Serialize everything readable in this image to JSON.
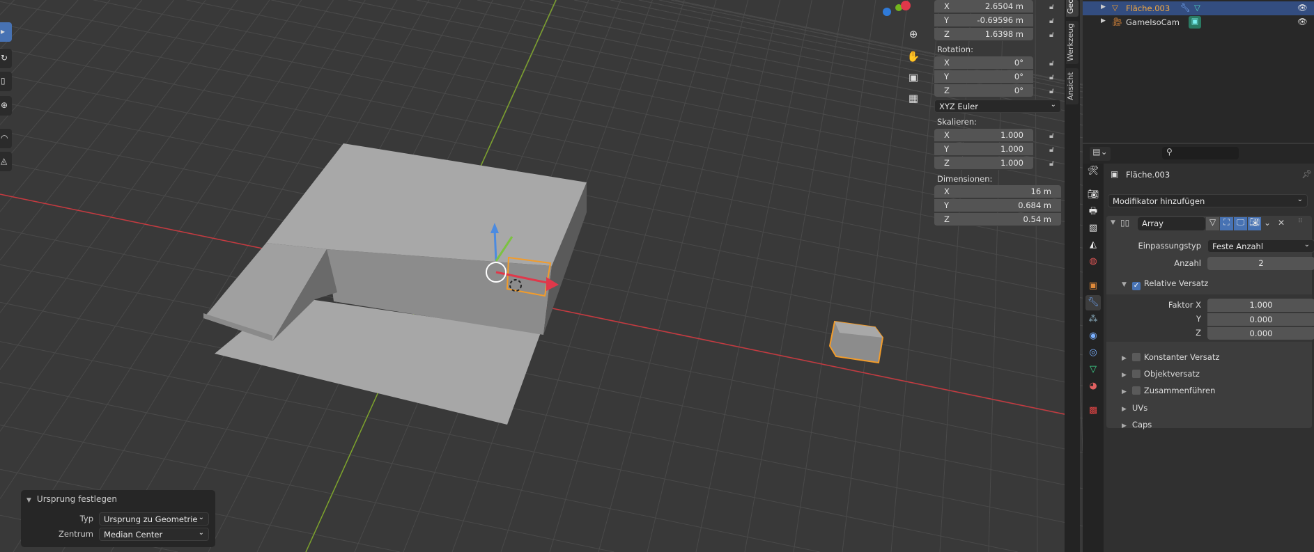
{
  "toolbar": {
    "tools": [
      "select-box",
      "cursor",
      "move",
      "scale",
      "transform",
      "annotate",
      "measure"
    ]
  },
  "npanel": {
    "location": [
      {
        "axis": "X",
        "value": "2.6504 m"
      },
      {
        "axis": "Y",
        "value": "-0.69596 m"
      },
      {
        "axis": "Z",
        "value": "1.6398 m"
      }
    ],
    "rotation_label": "Rotation:",
    "rotation": [
      {
        "axis": "X",
        "value": "0°"
      },
      {
        "axis": "Y",
        "value": "0°"
      },
      {
        "axis": "Z",
        "value": "0°"
      }
    ],
    "rotation_mode": "XYZ Euler",
    "scale_label": "Skalieren:",
    "scale": [
      {
        "axis": "X",
        "value": "1.000"
      },
      {
        "axis": "Y",
        "value": "1.000"
      },
      {
        "axis": "Z",
        "value": "1.000"
      }
    ],
    "dimensions_label": "Dimensionen:",
    "dimensions": [
      {
        "axis": "X",
        "value": "16 m"
      },
      {
        "axis": "Y",
        "value": "0.684 m"
      },
      {
        "axis": "Z",
        "value": "0.54 m"
      }
    ]
  },
  "side_tabs": [
    "Geo",
    "Werkzeug",
    "Ansicht"
  ],
  "outliner": {
    "items": [
      {
        "name": "Fläche.003",
        "selected": true
      },
      {
        "name": "GameIsoCam",
        "selected": false
      }
    ]
  },
  "properties": {
    "object_name": "Fläche.003",
    "add_modifier": "Modifikator hinzufügen",
    "modifier": {
      "name": "Array",
      "fit_type_label": "Einpassungstyp",
      "fit_type": "Feste Anzahl",
      "count_label": "Anzahl",
      "count": "2",
      "relative_offset": "Relative Versatz",
      "factor_x_label": "Faktor X",
      "factor_x": "1.000",
      "factor_y_label": "Y",
      "factor_y": "0.000",
      "factor_z_label": "Z",
      "factor_z": "0.000",
      "constant_offset": "Konstanter Versatz",
      "object_offset": "Objektversatz",
      "merge": "Zusammenführen",
      "uvs": "UVs",
      "caps": "Caps"
    }
  },
  "operator_panel": {
    "title": "Ursprung festlegen",
    "type_label": "Typ",
    "type_value": "Ursprung zu Geometrie",
    "center_label": "Zentrum",
    "center_value": "Median Center"
  },
  "colors": {
    "accent": "#4772b3",
    "selection": "#f39c2a",
    "x_axis": "#c8393f",
    "y_axis": "#7da32c"
  }
}
